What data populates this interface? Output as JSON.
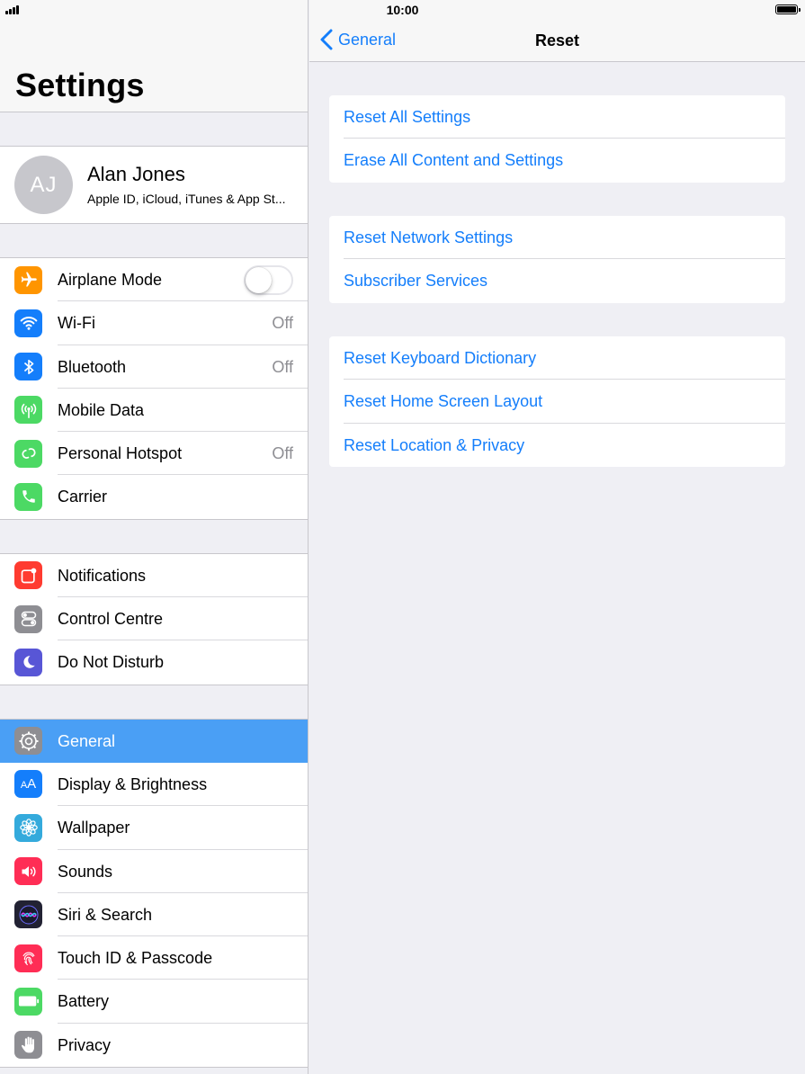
{
  "status_bar": {
    "time": "10:00"
  },
  "sidebar": {
    "title": "Settings",
    "profile": {
      "initials": "AJ",
      "name": "Alan Jones",
      "subtitle": "Apple ID, iCloud, iTunes & App St..."
    },
    "group1": [
      {
        "label": "Airplane Mode",
        "icon": "airplane-icon",
        "color": "#ff9500",
        "control": "toggle-off"
      },
      {
        "label": "Wi-Fi",
        "icon": "wifi-icon",
        "color": "#147efb",
        "value": "Off"
      },
      {
        "label": "Bluetooth",
        "icon": "bluetooth-icon",
        "color": "#147efb",
        "value": "Off"
      },
      {
        "label": "Mobile Data",
        "icon": "antenna-icon",
        "color": "#4cd964",
        "value": ""
      },
      {
        "label": "Personal Hotspot",
        "icon": "hotspot-icon",
        "color": "#4cd964",
        "value": "Off"
      },
      {
        "label": "Carrier",
        "icon": "phone-icon",
        "color": "#4cd964",
        "value": ""
      }
    ],
    "group2": [
      {
        "label": "Notifications",
        "icon": "notifications-icon",
        "color": "#ff3b30"
      },
      {
        "label": "Control Centre",
        "icon": "control-centre-icon",
        "color": "#8e8e93"
      },
      {
        "label": "Do Not Disturb",
        "icon": "moon-icon",
        "color": "#5856d6"
      }
    ],
    "group3": [
      {
        "label": "General",
        "icon": "gear-icon",
        "color": "#8e8e93",
        "selected": true
      },
      {
        "label": "Display & Brightness",
        "icon": "display-icon",
        "color": "#147efb"
      },
      {
        "label": "Wallpaper",
        "icon": "wallpaper-icon",
        "color": "#34aadc"
      },
      {
        "label": "Sounds",
        "icon": "speaker-icon",
        "color": "#ff2d55"
      },
      {
        "label": "Siri & Search",
        "icon": "siri-icon",
        "color": "#222233"
      },
      {
        "label": "Touch ID & Passcode",
        "icon": "fingerprint-icon",
        "color": "#ff2d55"
      },
      {
        "label": "Battery",
        "icon": "battery-icon",
        "color": "#4cd964"
      },
      {
        "label": "Privacy",
        "icon": "hand-icon",
        "color": "#8e8e93"
      }
    ]
  },
  "detail": {
    "back_label": "General",
    "title": "Reset",
    "groups": [
      [
        "Reset All Settings",
        "Erase All Content and Settings"
      ],
      [
        "Reset Network Settings",
        "Subscriber Services"
      ],
      [
        "Reset Keyboard Dictionary",
        "Reset Home Screen Layout",
        "Reset Location & Privacy"
      ]
    ]
  }
}
